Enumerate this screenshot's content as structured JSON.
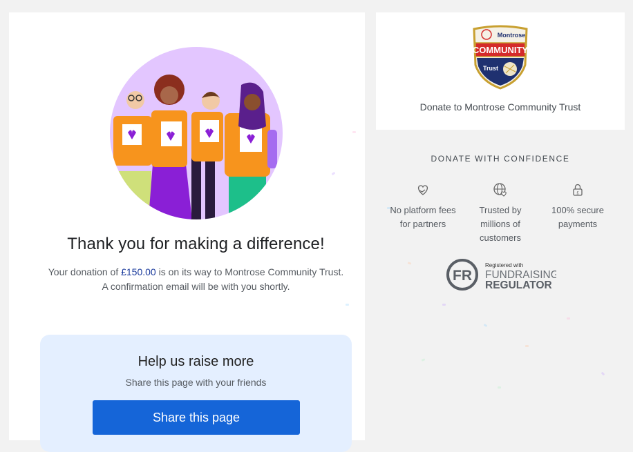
{
  "thank_you": {
    "title": "Thank you for making a difference!",
    "donation_prefix": "Your donation of ",
    "amount": "£150.00",
    "donation_suffix": " is on its way to Montrose Community Trust.",
    "confirmation": "A confirmation email will be with you shortly."
  },
  "share": {
    "title": "Help us raise more",
    "subtitle": "Share this page with your friends",
    "button_label": "Share this page"
  },
  "charity": {
    "logo_line1": "Montrose",
    "logo_line2": "COMMUNITY",
    "logo_line3": "Trust",
    "donate_to": "Donate to Montrose Community Trust"
  },
  "confidence": {
    "title": "DONATE WITH CONFIDENCE",
    "features": [
      {
        "icon": "heart-hand-icon",
        "line1": "No platform fees",
        "line2": "for partners",
        "line3": ""
      },
      {
        "icon": "globe-heart-icon",
        "line1": "Trusted by",
        "line2": "millions of",
        "line3": "customers"
      },
      {
        "icon": "padlock-icon",
        "line1": "100% secure",
        "line2": "payments",
        "line3": ""
      }
    ]
  },
  "regulator": {
    "monogram": "FR",
    "registered": "Registered with",
    "line1": "FUNDRAISING",
    "line2": "REGULATOR"
  },
  "colors": {
    "accent": "#1565d8",
    "amount": "#1a3a9c",
    "share_bg": "#e4efff",
    "hero_bg": "#e3c6ff",
    "orange": "#f7941d",
    "purple": "#8a1fd6"
  }
}
